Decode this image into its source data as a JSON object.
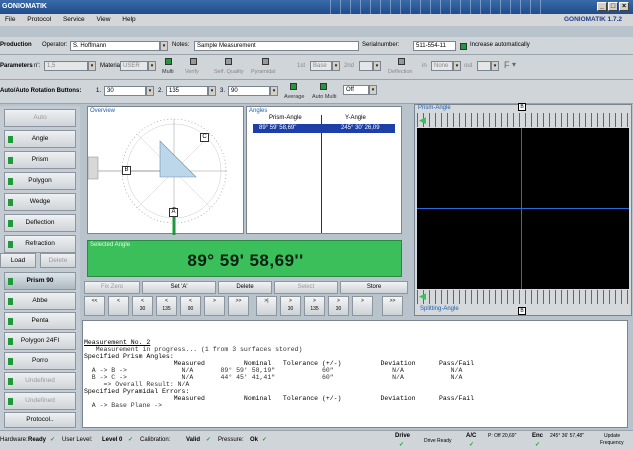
{
  "titlebar": {
    "title": "GONIOMATIK",
    "min": "_",
    "max": "□",
    "close": "×"
  },
  "menu": {
    "items": [
      "File",
      "Protocol",
      "Service",
      "View",
      "Help"
    ],
    "brand": "GONIOMATIK 1.7.2"
  },
  "production": {
    "label": "Production",
    "operator_label": "Operator:",
    "operator_value": "S. Hoffmann",
    "notes_label": "Notes:",
    "notes_value": "Sample Measurement",
    "serial_label": "Serialnumber:",
    "serial_value": "511-554-11",
    "increase_label": "Increase automatically"
  },
  "parameters": {
    "label": "Parameters",
    "n_label": "n':",
    "n_value": "1,5",
    "material_label": "Material:",
    "material_value": "USER",
    "multi": "Multi",
    "verify": "Verify",
    "self_quality": "Self. Quality",
    "pyramidal": "Pyramidal",
    "first_label": "1st",
    "first_value": "Base",
    "second_label": "2nd",
    "deflection_label": "Deflection",
    "in_label": "in",
    "in_value": "None",
    "out_label": "out",
    "f_label": "F"
  },
  "rotation": {
    "label": "Auto/Auto Rotation Buttons:",
    "v1_label": "1.",
    "v1": "30",
    "v2_label": "2.",
    "v2": "135",
    "v3_label": "3.",
    "v3": "90",
    "average": "Average",
    "auto_multi": "Auto Multi",
    "off": "Off"
  },
  "sidebar": [
    {
      "label": "Auto",
      "style": "dim"
    },
    {
      "label": "Angle",
      "style": "led"
    },
    {
      "label": "Prism",
      "style": "led"
    },
    {
      "label": "Polygon",
      "style": "led"
    },
    {
      "label": "Wedge",
      "style": "led"
    },
    {
      "label": "Deflection",
      "style": "led"
    },
    {
      "label": "Refraction",
      "style": "led"
    }
  ],
  "load": {
    "load": "Load",
    "delete": "Delete"
  },
  "sidebar2": [
    {
      "label": "Prism 90",
      "style": "act"
    },
    {
      "label": "Abbe",
      "style": "led"
    },
    {
      "label": "Penta",
      "style": "led"
    },
    {
      "label": "Polygon 24FI",
      "style": "led"
    },
    {
      "label": "Porro",
      "style": "led"
    },
    {
      "label": "Undefined",
      "style": "dim"
    },
    {
      "label": "Undefined",
      "style": "dim"
    },
    {
      "label": "Protocol..",
      "style": "plain"
    }
  ],
  "overview": {
    "title": "Overview",
    "marker_b": "B",
    "marker_c": "C",
    "marker_a": "A"
  },
  "angles": {
    "title": "Angles",
    "col1": "Prism-Angle",
    "col2": "Y-Angle",
    "row_prism": "89° 59' 58,69\"",
    "row_y": "245° 30' 26,09"
  },
  "selected": {
    "title": "Selected Angle",
    "value": "89° 59' 58,69''"
  },
  "actions": {
    "fix_zero": "Fix Zero",
    "set_a": "Set 'A'",
    "delete": "Delete",
    "select": "Select",
    "store": "Store"
  },
  "nav": [
    {
      "top": "<<",
      "bottom": ""
    },
    {
      "top": "<",
      "bottom": ""
    },
    {
      "top": "<",
      "bottom": "30"
    },
    {
      "top": "<",
      "bottom": "135"
    },
    {
      "top": "<",
      "bottom": "90"
    },
    {
      "top": ">",
      "bottom": ""
    },
    {
      "top": ">>",
      "bottom": ""
    },
    {
      "top": ">|",
      "bottom": ""
    },
    {
      "top": ">",
      "bottom": "30"
    },
    {
      "top": ">",
      "bottom": "135"
    },
    {
      "top": ">",
      "bottom": "30"
    },
    {
      "top": ">",
      "bottom": ""
    },
    {
      "top": ">>",
      "bottom": ""
    }
  ],
  "display": {
    "top_title": "Prism-Angle",
    "bottom_title": "Splitting-Angle",
    "marker": "B"
  },
  "console": {
    "lines": [
      "Measurement No. 2",
      "   Measurement in progress... (1 from 3 surfaces stored)",
      "Specified Prism Angles:",
      "                       Measured          Nominal   Tolerance (+/-)          Deviation      Pass/Fail",
      "  A -> B ->              N/A       89° 59' 58,19\"            60\"               N/A            N/A",
      "  B -> C ->              N/A       44° 45' 41,41\"            60\"               N/A            N/A",
      "     => Overall Result: N/A",
      "Specified Pyramidal Errors:",
      "                       Measured          Nominal   Tolerance (+/-)          Deviation      Pass/Fail",
      "  A -> Base Plane ->"
    ]
  },
  "status": {
    "hardware": "Hardware:",
    "hardware_val": "Ready",
    "user_level": "User Level:",
    "user_level_val": "Level 0",
    "calibration": "Calibration:",
    "calibration_val": "Valid",
    "pressure": "Pressure:",
    "pressure_val": "Ok",
    "drive": "Drive",
    "drive_ready": "Drive Ready",
    "ac": "A/C",
    "ac_val": "P: Off 20,69\"",
    "enc": "Enc",
    "enc_val": "245° 36' 57,48\"",
    "update": "Update",
    "update_val": "Frequency"
  },
  "colors": {
    "accent": "#1d5fb0",
    "led_green": "#1e9a3a",
    "selected_bg": "#3bbf5a"
  }
}
